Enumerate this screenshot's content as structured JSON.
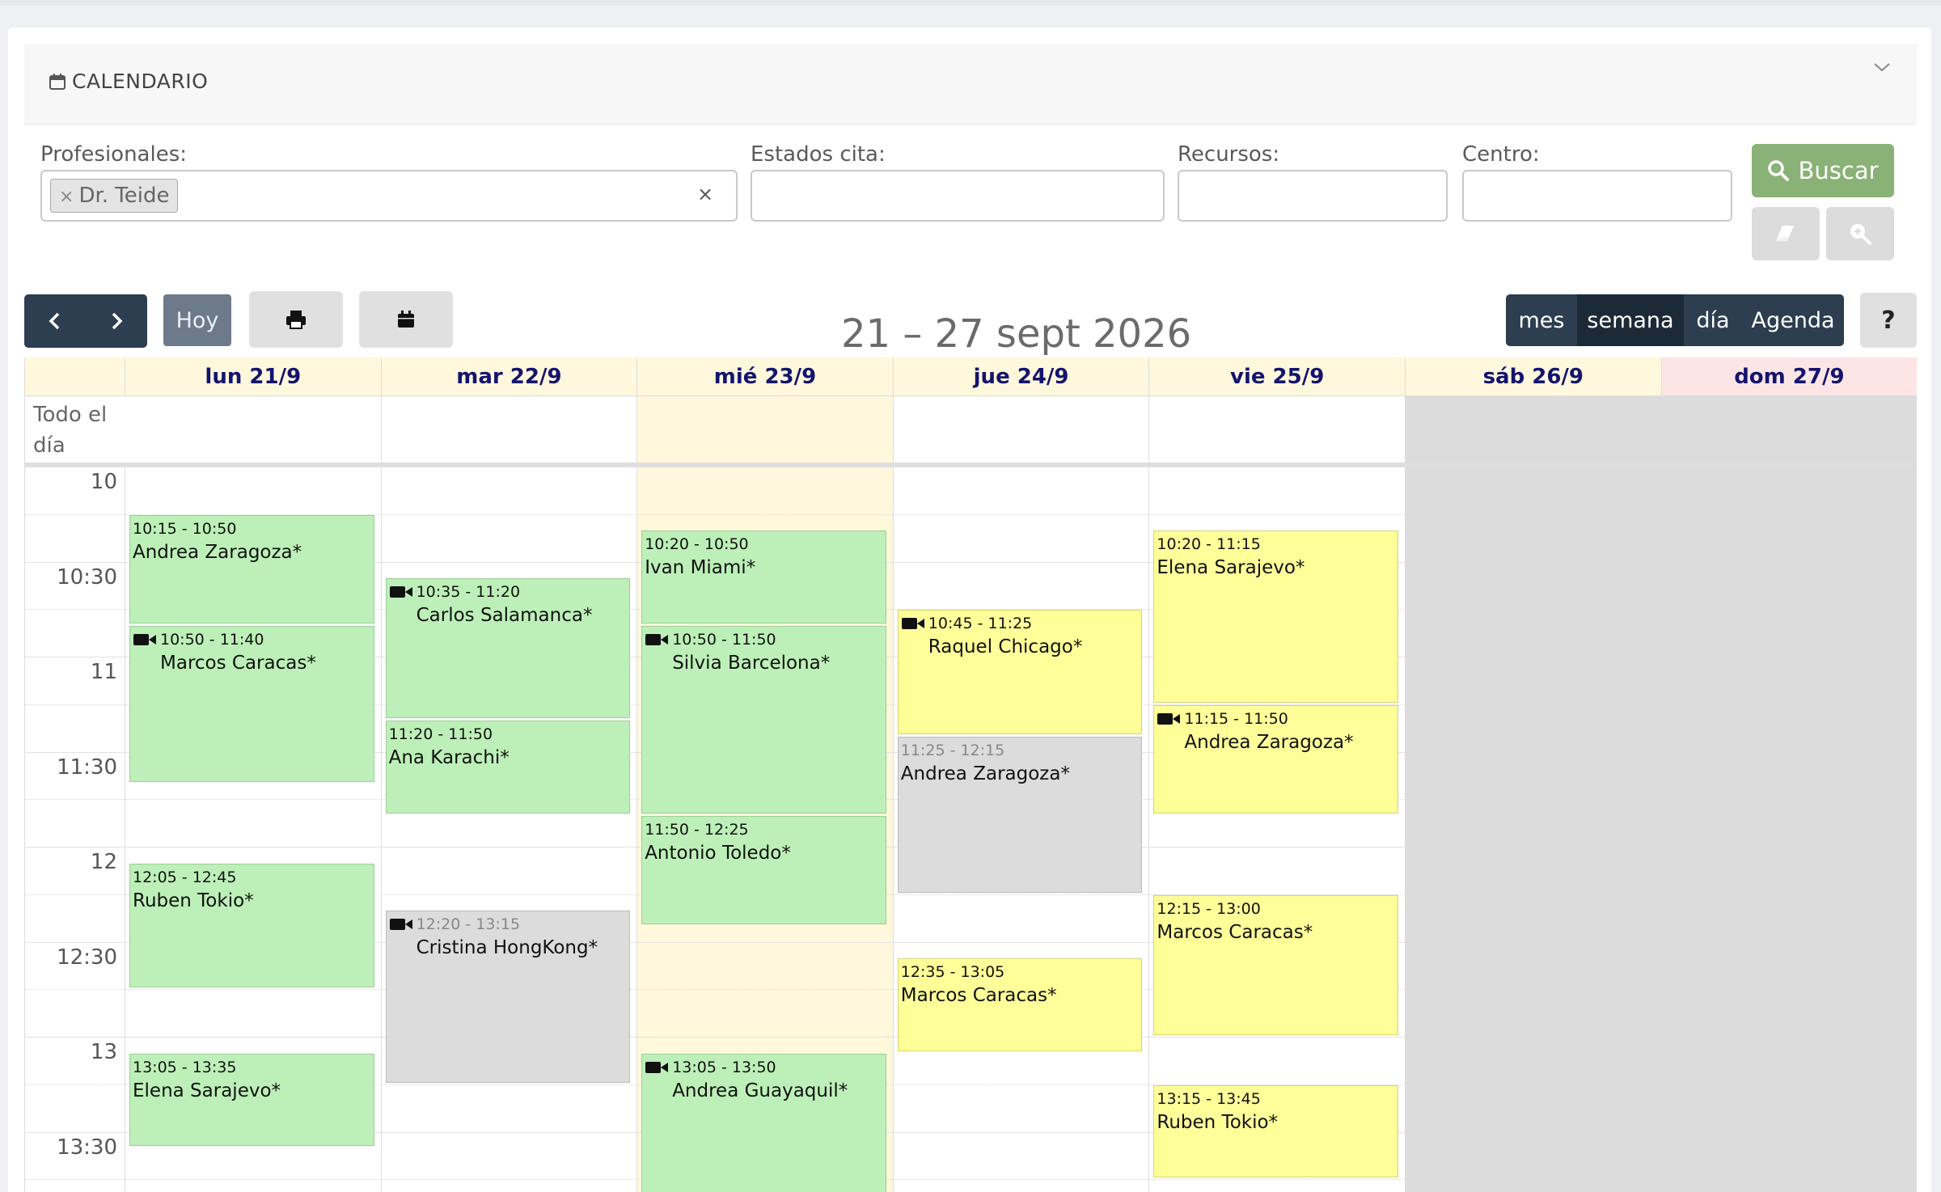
{
  "card": {
    "title": "CALENDARIO"
  },
  "filters": {
    "profesionales_label": "Profesionales:",
    "profesional_tag": "Dr. Teide",
    "tag_remove": "×",
    "clear": "×",
    "estados_label": "Estados cita:",
    "recursos_label": "Recursos:",
    "centro_label": "Centro:",
    "search_label": "Buscar"
  },
  "toolbar": {
    "today_label": "Hoy",
    "range_title": "21 – 27 sept 2026",
    "views": [
      "mes",
      "semana",
      "día",
      "Agenda"
    ],
    "active_view": "semana",
    "help_label": "?"
  },
  "calendar": {
    "allday_label": "Todo el día",
    "days": [
      {
        "label": "lun 21/9",
        "type": "normal"
      },
      {
        "label": "mar 22/9",
        "type": "normal"
      },
      {
        "label": "mié 23/9",
        "type": "today"
      },
      {
        "label": "jue 24/9",
        "type": "normal"
      },
      {
        "label": "vie 25/9",
        "type": "normal"
      },
      {
        "label": "sáb 26/9",
        "type": "weekend"
      },
      {
        "label": "dom 27/9",
        "type": "weekend"
      }
    ],
    "time_labels": [
      "10",
      "10:30",
      "11",
      "11:30",
      "12",
      "12:30",
      "13",
      "13:30"
    ],
    "events": [
      {
        "day": 0,
        "time": "10:15 - 10:50",
        "name": "Andrea Zaragoza*",
        "status": "green",
        "video": false
      },
      {
        "day": 0,
        "time": "10:50 - 11:40",
        "name": "Marcos Caracas*",
        "status": "green",
        "video": true
      },
      {
        "day": 0,
        "time": "12:05 - 12:45",
        "name": "Ruben Tokio*",
        "status": "green",
        "video": false
      },
      {
        "day": 0,
        "time": "13:05 - 13:35",
        "name": "Elena Sarajevo*",
        "status": "green",
        "video": false
      },
      {
        "day": 1,
        "time": "10:35 - 11:20",
        "name": "Carlos Salamanca*",
        "status": "green",
        "video": true
      },
      {
        "day": 1,
        "time": "11:20 - 11:50",
        "name": "Ana Karachi*",
        "status": "green",
        "video": false
      },
      {
        "day": 1,
        "time": "12:20 - 13:15",
        "name": "Cristina HongKong*",
        "status": "grey",
        "video": true
      },
      {
        "day": 2,
        "time": "10:20 - 10:50",
        "name": "Ivan Miami*",
        "status": "green",
        "video": false
      },
      {
        "day": 2,
        "time": "10:50 - 11:50",
        "name": "Silvia Barcelona*",
        "status": "green",
        "video": true
      },
      {
        "day": 2,
        "time": "11:50 - 12:25",
        "name": "Antonio Toledo*",
        "status": "green",
        "video": false
      },
      {
        "day": 2,
        "time": "13:05 - 13:50",
        "name": "Andrea Guayaquil*",
        "status": "green",
        "video": true
      },
      {
        "day": 3,
        "time": "10:45 - 11:25",
        "name": "Raquel Chicago*",
        "status": "yellow",
        "video": true
      },
      {
        "day": 3,
        "time": "11:25 - 12:15",
        "name": "Andrea Zaragoza*",
        "status": "grey",
        "video": false
      },
      {
        "day": 3,
        "time": "12:35 - 13:05",
        "name": "Marcos Caracas*",
        "status": "yellow",
        "video": false
      },
      {
        "day": 4,
        "time": "10:20 - 11:15",
        "name": "Elena Sarajevo*",
        "status": "yellow",
        "video": false
      },
      {
        "day": 4,
        "time": "11:15 - 11:50",
        "name": "Andrea Zaragoza*",
        "status": "yellow",
        "video": true
      },
      {
        "day": 4,
        "time": "12:15 - 13:00",
        "name": "Marcos Caracas*",
        "status": "yellow",
        "video": false
      },
      {
        "day": 4,
        "time": "13:15 - 13:45",
        "name": "Ruben Tokio*",
        "status": "yellow",
        "video": false
      }
    ]
  },
  "colors": {
    "green": "#bdf0b8",
    "yellow": "#ffff99",
    "grey": "#dcdcdc",
    "nav": "#2c3e50",
    "search": "#8ab276",
    "dayhead": "#14146e"
  }
}
